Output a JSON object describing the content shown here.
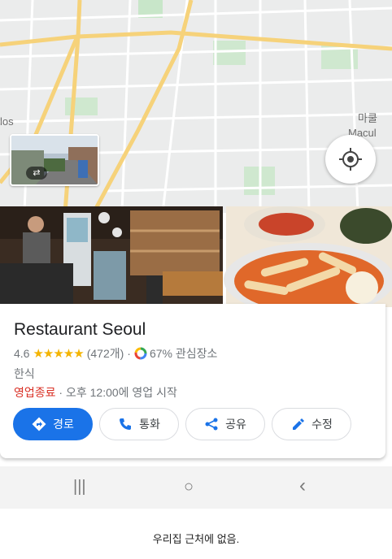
{
  "map": {
    "labels": {
      "left_place": "los",
      "right_korean": "마쿨",
      "right_latin": "Macul"
    },
    "street_view_icon": "street-view-arrow-icon",
    "locate_icon": "my-location-icon"
  },
  "place": {
    "name": "Restaurant Seoul",
    "rating": "4.6",
    "stars": "★★★★★",
    "review_count": "(472개)",
    "separator": "·",
    "interest": "67% 관심장소",
    "category": "한식",
    "status": "영업종료",
    "hours": "· 오후 12:00에 영업 시작"
  },
  "actions": [
    {
      "label": "경로",
      "icon": "directions-icon"
    },
    {
      "label": "통화",
      "icon": "phone-icon"
    },
    {
      "label": "공유",
      "icon": "share-icon"
    },
    {
      "label": "수정",
      "icon": "edit-icon"
    }
  ],
  "navbar": {
    "recent": "|||",
    "home": "○",
    "back": "‹"
  },
  "caption": "우리집 근처에 없음.",
  "colors": {
    "accent": "#1a73e8",
    "star": "#f4b400",
    "closed": "#d93025",
    "map_bg": "#ebecec",
    "road_major": "#f6d27a"
  }
}
